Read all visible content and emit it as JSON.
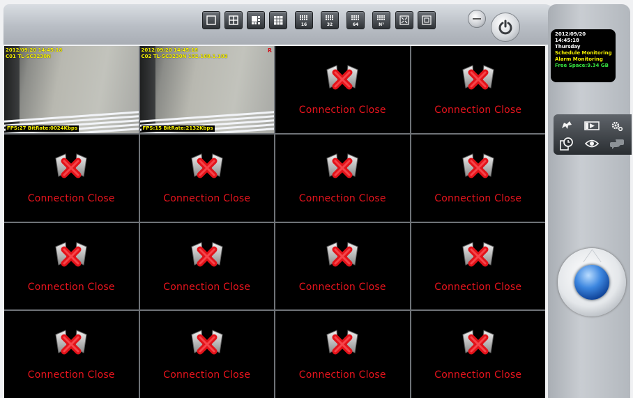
{
  "toolbar": {
    "layout_buttons": [
      {
        "name": "layout-1-button",
        "icon": "single-view-icon",
        "label": ""
      },
      {
        "name": "layout-4-button",
        "icon": "quad-view-icon",
        "label": ""
      },
      {
        "name": "layout-6-button",
        "icon": "six-view-icon",
        "label": ""
      },
      {
        "name": "layout-9-button",
        "icon": "nine-view-icon",
        "label": ""
      },
      {
        "name": "layout-16-button",
        "icon": "grid-16-icon",
        "label": "16"
      },
      {
        "name": "layout-32-button",
        "icon": "grid-32-icon",
        "label": "32"
      },
      {
        "name": "layout-64-button",
        "icon": "grid-64-icon",
        "label": "64"
      },
      {
        "name": "layout-custom-button",
        "icon": "grid-custom-icon",
        "label": "N²"
      },
      {
        "name": "fullscreen-button",
        "icon": "fullscreen-icon",
        "label": ""
      },
      {
        "name": "screenshot-button",
        "icon": "capture-icon",
        "label": ""
      }
    ]
  },
  "info": {
    "date": "2012/09/20",
    "time": "14:45:18",
    "weekday": "Thursday",
    "schedule": "Schedule Monitoring",
    "alarm": "Alarm Monitoring",
    "free_space": "Free Space:9.34 GB"
  },
  "cameras": [
    {
      "timestamp": "2012/09/20 14:45:18",
      "name": "C01 TL-SC3230N",
      "stats": "FPS:27 BitRate:0024Kbps"
    },
    {
      "timestamp": "2012/09/20 14:45:18",
      "name": "C02 TL-SC3230N 192.168.1.103",
      "stats": "FPS:15 BitRate:2132Kbps",
      "marker": "R"
    }
  ],
  "closed_text": "Connection Close",
  "colors": {
    "alert_red": "#e8141d",
    "overlay_yellow": "#f6f000",
    "free_space_green": "#35e240",
    "ptz_blue": "#3c86df"
  }
}
